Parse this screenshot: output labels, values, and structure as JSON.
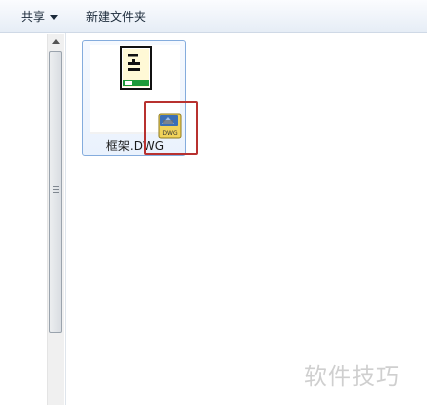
{
  "toolbar": {
    "share_label": "共享",
    "new_folder_label": "新建文件夹"
  },
  "file": {
    "name": "框架.DWG",
    "icon": "dwg-file-icon",
    "overlay_icon_label": "DWG"
  },
  "watermark": {
    "text": "软件技巧"
  },
  "colors": {
    "selection_border": "#84acdd",
    "highlight_border": "#b8312f",
    "dwg_icon_body": "#f1d35b",
    "dwg_icon_accent": "#3c6fb5"
  }
}
